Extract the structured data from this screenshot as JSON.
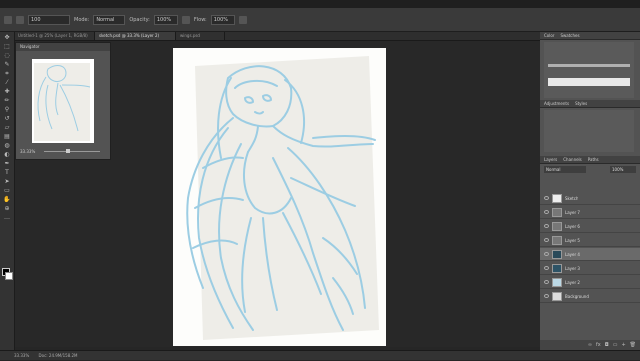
{
  "options": {
    "brush_size": "100",
    "mode_label": "Mode:",
    "mode_value": "Normal",
    "opacity_label": "Opacity:",
    "opacity_value": "100%",
    "flow_label": "Flow:",
    "flow_value": "100%"
  },
  "tabs": [
    {
      "label": "Untitled-1 @ 25% (Layer 1, RGB/8)"
    },
    {
      "label": "sketch.psd @ 33.3% (Layer 2)"
    },
    {
      "label": "wings.psd"
    }
  ],
  "navigator": {
    "title": "Navigator",
    "zoom": "33.33%"
  },
  "panels": {
    "top_tabs": [
      "Color",
      "Swatches"
    ],
    "mid_tabs": [
      "Adjustments",
      "Styles"
    ],
    "layers_tabs": [
      "Layers",
      "Channels",
      "Paths"
    ],
    "blend_mode": "Normal",
    "opacity": "100%"
  },
  "layers": [
    {
      "name": "Sketch"
    },
    {
      "name": "Layer 7"
    },
    {
      "name": "Layer 6"
    },
    {
      "name": "Layer 5"
    },
    {
      "name": "Layer 4"
    },
    {
      "name": "Layer 3"
    },
    {
      "name": "Layer 2"
    },
    {
      "name": "Background"
    }
  ],
  "status": {
    "zoom": "33.33%",
    "doc": "Doc: 24.9M/158.2M"
  },
  "colors": {
    "sketch_stroke": "#9ccde3",
    "paper": "#eeede8"
  }
}
